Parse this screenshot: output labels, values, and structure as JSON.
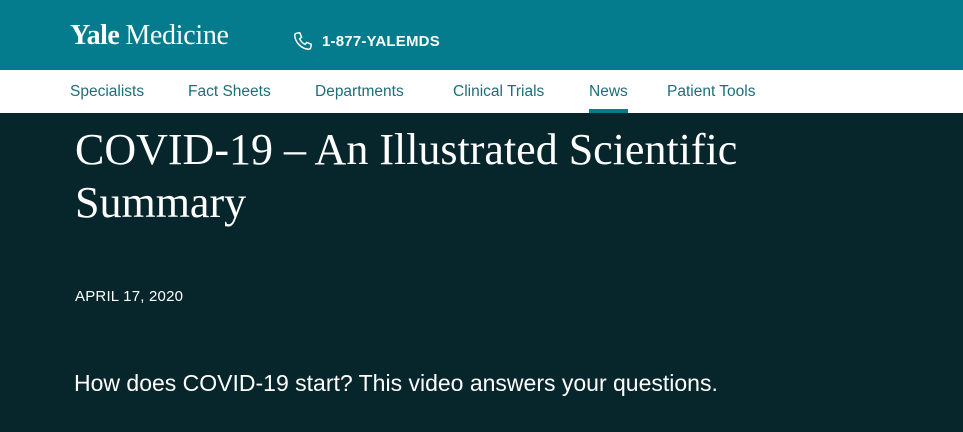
{
  "header": {
    "logo": {
      "yale": "Yale",
      "medicine": "Medicine"
    },
    "phone": {
      "icon": "phone-icon",
      "number": "1-877-YALEMDS"
    },
    "background_color": "#047c8d"
  },
  "nav": {
    "items": [
      {
        "label": "Specialists",
        "active": false
      },
      {
        "label": "Fact Sheets",
        "active": false
      },
      {
        "label": "Departments",
        "active": false
      },
      {
        "label": "Clinical Trials",
        "active": false
      },
      {
        "label": "News",
        "active": true
      },
      {
        "label": "Patient Tools",
        "active": false
      }
    ],
    "text_color": "#1c6e79",
    "active_indicator_color": "#047c8d"
  },
  "article": {
    "title": "COVID-19 – An Illustrated Scientific Summary",
    "date": "APRIL 17, 2020",
    "subtitle": "How does COVID-19 start? This video answers your questions.",
    "background_color": "#06262c"
  }
}
